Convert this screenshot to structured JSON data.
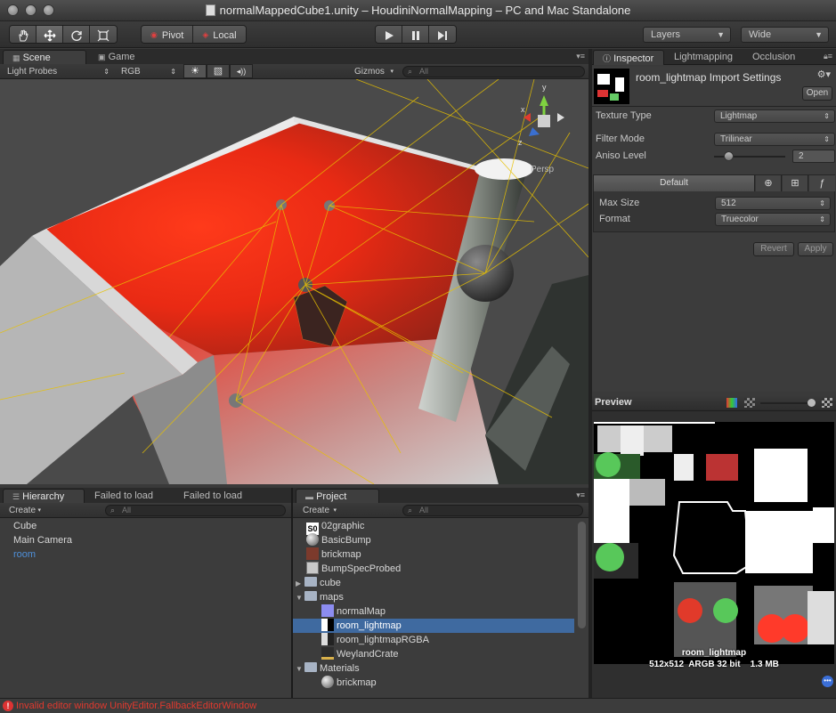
{
  "window": {
    "title": "normalMappedCube1.unity – HoudiniNormalMapping – PC and Mac Standalone"
  },
  "toolbar": {
    "tools": [
      "hand-icon",
      "move-icon",
      "rotate-icon",
      "scale-icon"
    ],
    "pivot_label": "Pivot",
    "local_label": "Local",
    "play_controls": [
      "play-icon",
      "pause-icon",
      "step-icon"
    ],
    "layers_label": "Layers",
    "layout_label": "Wide"
  },
  "scene_panel": {
    "tabs": [
      "Scene",
      "Game"
    ],
    "render_mode": "Light Probes",
    "color_mode": "RGB",
    "gizmos_label": "Gizmos",
    "search_placeholder": "All",
    "persp_label": "Persp",
    "axis_labels": {
      "x": "x",
      "y": "y",
      "z": "z"
    }
  },
  "hierarchy": {
    "tabs": [
      "Hierarchy",
      "Failed to load",
      "Failed to load"
    ],
    "create_label": "Create",
    "search_placeholder": "All",
    "items": [
      {
        "label": "Cube"
      },
      {
        "label": "Main Camera"
      },
      {
        "label": "room",
        "highlight": true
      }
    ]
  },
  "project": {
    "tab": "Project",
    "create_label": "Create",
    "search_placeholder": "All",
    "items": [
      {
        "label": "02graphic",
        "indent": 0,
        "icon": "font-asset-icon"
      },
      {
        "label": "BasicBump",
        "indent": 0,
        "icon": "material-sphere-icon"
      },
      {
        "label": "brickmap",
        "indent": 0,
        "icon": "texture-icon"
      },
      {
        "label": "BumpSpecProbed",
        "indent": 0,
        "icon": "shader-icon"
      },
      {
        "label": "cube",
        "indent": 0,
        "icon": "folder-icon",
        "expandable": "collapsed"
      },
      {
        "label": "maps",
        "indent": 0,
        "icon": "folder-icon",
        "expandable": "expanded"
      },
      {
        "label": "normalMap",
        "indent": 1,
        "icon": "texture-icon"
      },
      {
        "label": "room_lightmap",
        "indent": 1,
        "icon": "texture-icon",
        "selected": true
      },
      {
        "label": "room_lightmapRGBA",
        "indent": 1,
        "icon": "texture-icon"
      },
      {
        "label": "WeylandCrate",
        "indent": 1,
        "icon": "texture-icon"
      },
      {
        "label": "Materials",
        "indent": 0,
        "icon": "folder-icon",
        "expandable": "expanded"
      },
      {
        "label": "brickmap",
        "indent": 1,
        "icon": "material-sphere-icon"
      }
    ]
  },
  "inspector": {
    "tabs": [
      "Inspector",
      "Lightmapping",
      "Occlusion"
    ],
    "asset_title": "room_lightmap Import Settings",
    "open_button": "Open",
    "texture_type_label": "Texture Type",
    "texture_type_value": "Lightmap",
    "filter_mode_label": "Filter Mode",
    "filter_mode_value": "Trilinear",
    "aniso_label": "Aniso Level",
    "aniso_value": "2",
    "aniso_level_fraction": 0.2,
    "platform_default": "Default",
    "max_size_label": "Max Size",
    "max_size_value": "512",
    "format_label": "Format",
    "format_value": "Truecolor",
    "revert_button": "Revert",
    "apply_button": "Apply"
  },
  "preview": {
    "header": "Preview",
    "name": "room_lightmap",
    "info": "512x512  ARGB 32 bit    1.3 MB"
  },
  "status": {
    "message": "Invalid editor window UnityEditor.FallbackEditorWindow"
  },
  "colors": {
    "selection": "#3f6aa0",
    "error": "#e0392e",
    "highlight_text": "#4f8fd8"
  }
}
